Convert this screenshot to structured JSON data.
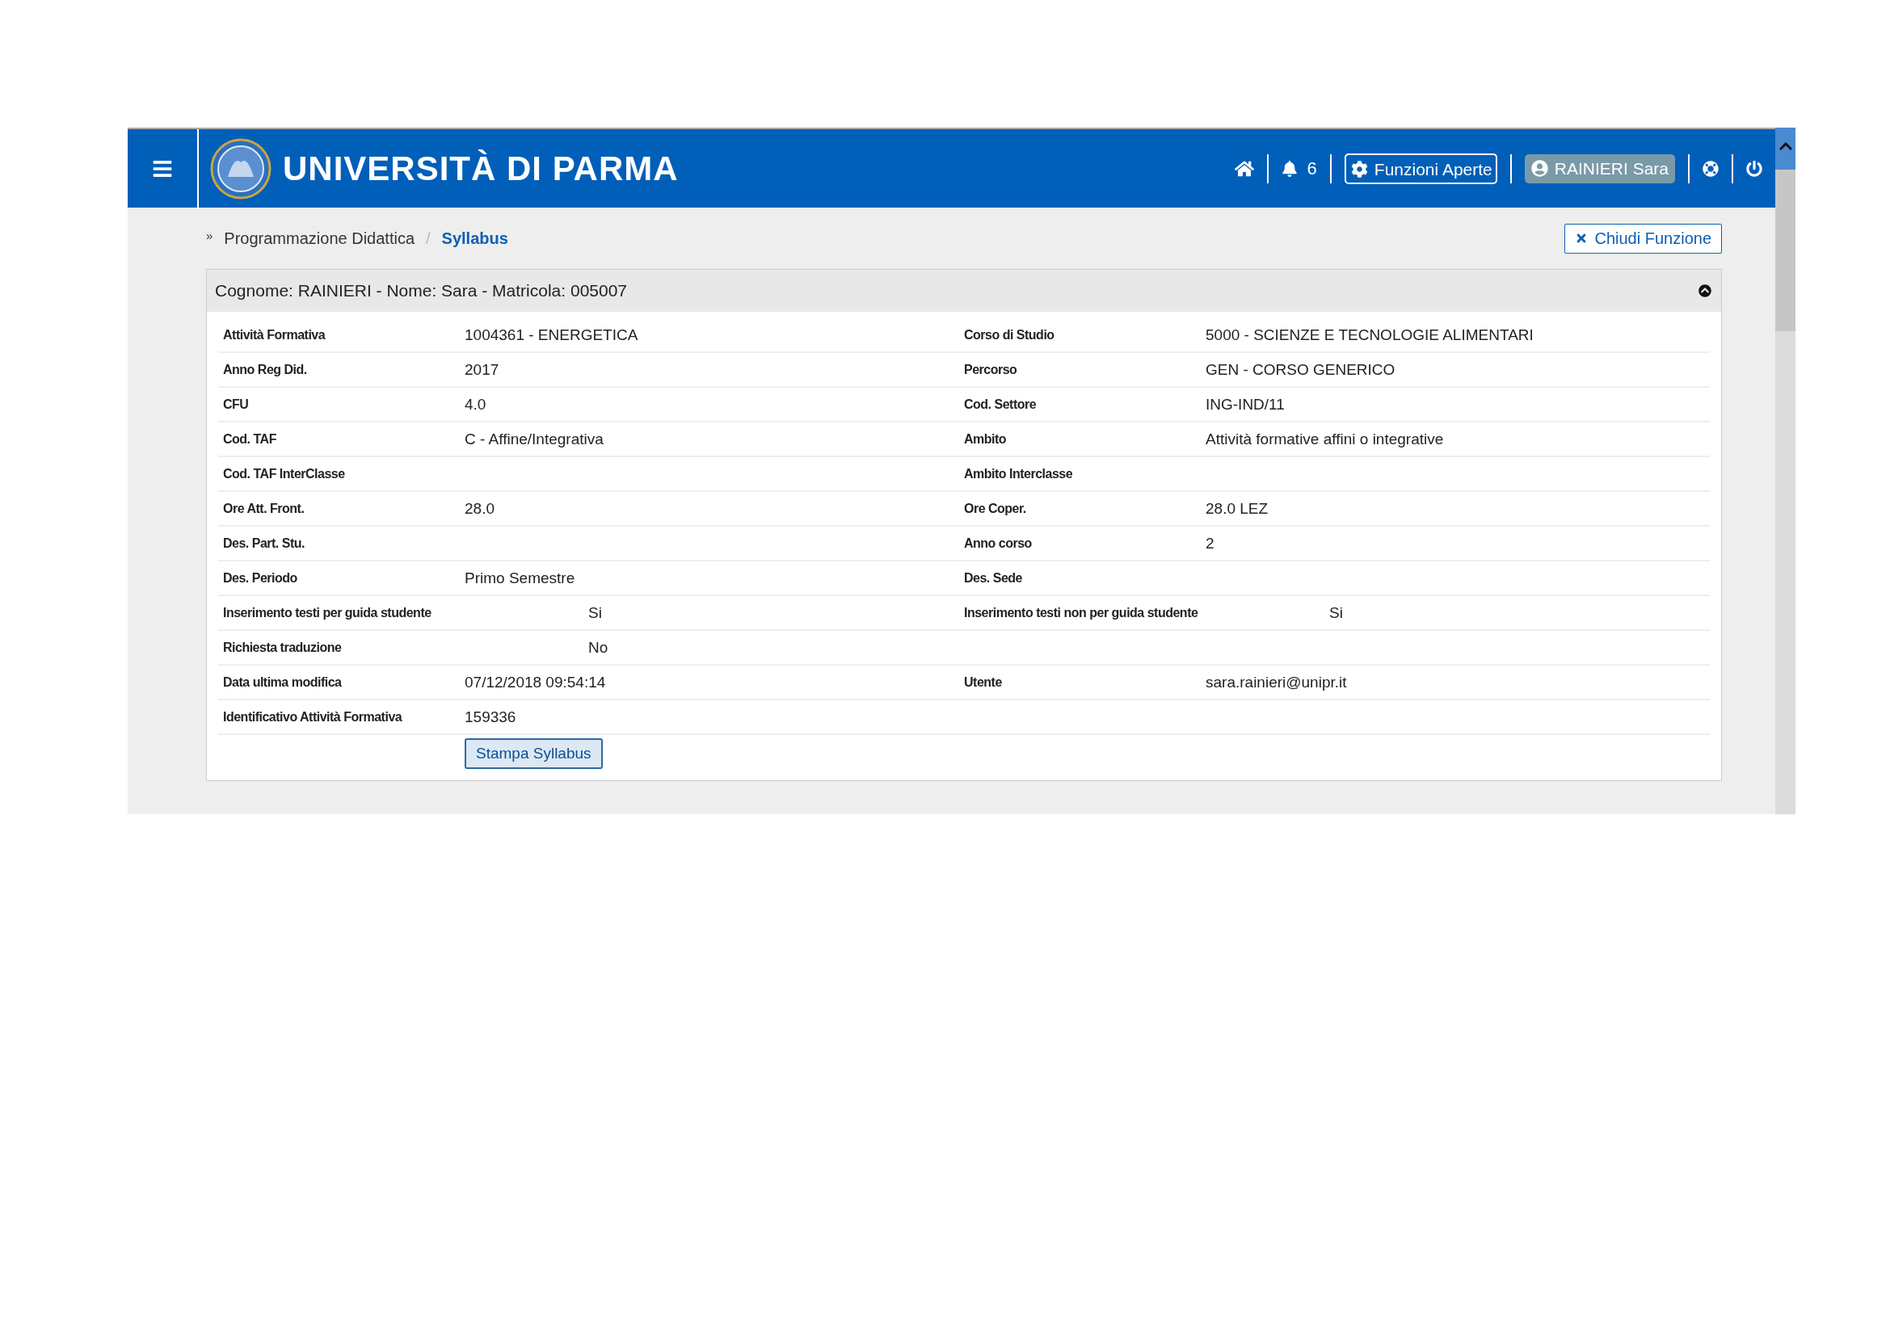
{
  "header": {
    "title": "UNIVERSITÀ DI PARMA",
    "notifications": "6",
    "open_functions": "Funzioni Aperte",
    "user": "RAINIERI Sara"
  },
  "breadcrumb_marker": "»",
  "breadcrumb_separator": "/",
  "breadcrumb": [
    {
      "label": "Programmazione Didattica",
      "selected": false
    },
    {
      "label": "Syllabus",
      "selected": true
    }
  ],
  "close_button": "Chiudi Funzione",
  "panel": {
    "title": "Cognome: RAINIERI - Nome: Sara - Matricola: 005007",
    "expanded": true,
    "rows": [
      [
        {
          "label": "Attività Formativa",
          "value": "1004361 - ENERGETICA",
          "kind": "plain"
        },
        {
          "label": "Corso di Studio",
          "value": "5000 - SCIENZE E TECNOLOGIE ALIMENTARI",
          "kind": "plain"
        }
      ],
      [
        {
          "label": "Anno Reg Did.",
          "value": "2017",
          "kind": "plain"
        },
        {
          "label": "Percorso",
          "value": "GEN - CORSO GENERICO",
          "kind": "plain"
        }
      ],
      [
        {
          "label": "CFU",
          "value": "4.0",
          "kind": "plain"
        },
        {
          "label": "Cod. Settore",
          "value": "ING-IND/11",
          "kind": "plain"
        }
      ],
      [
        {
          "label": "Cod. TAF",
          "value": "C - Affine/Integrativa",
          "kind": "plain"
        },
        {
          "label": "Ambito",
          "value": "Attività formative affini o integrative",
          "kind": "plain"
        }
      ],
      [
        {
          "label": "Cod. TAF InterClasse",
          "kind": "plain"
        },
        {
          "label": "Ambito Interclasse",
          "kind": "plain"
        }
      ],
      [
        {
          "label": "Ore Att. Front.",
          "value": "28.0",
          "kind": "plain"
        },
        {
          "label": "Ore Coper.",
          "value": "28.0 LEZ",
          "kind": "plain"
        }
      ],
      [
        {
          "label": "Des. Part. Stu.",
          "kind": "plain"
        },
        {
          "label": "Anno corso",
          "value": "2",
          "kind": "plain"
        }
      ],
      [
        {
          "label": "Des. Periodo",
          "value": "Primo Semestre",
          "kind": "plain"
        },
        {
          "label": "Des. Sede",
          "kind": "plain"
        }
      ],
      [
        {
          "label": "Inserimento testi per guida studente",
          "value": "Si",
          "kind": "indented"
        },
        {
          "label": "Inserimento testi non per guida studente",
          "value": "Si",
          "kind": "indented"
        }
      ],
      [
        {
          "label": "Richiesta traduzione",
          "value": "No",
          "kind": "indented"
        }
      ],
      [
        {
          "label": "Data ultima modifica",
          "value": "07/12/2018 09:54:14",
          "kind": "plain"
        },
        {
          "label": "Utente",
          "value": "sara.rainieri@unipr.it",
          "kind": "plain"
        }
      ],
      [
        {
          "label": "Identificativo Attività Formativa",
          "value": "159336",
          "kind": "plain"
        }
      ]
    ],
    "print_button": "Stampa Syllabus"
  }
}
